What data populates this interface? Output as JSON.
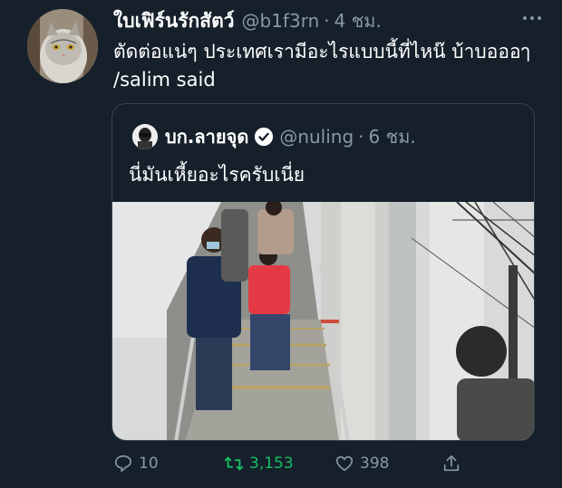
{
  "tweet": {
    "display_name": "ใบเฟิร์นรักสัตว์",
    "handle": "@b1f3rn",
    "separator": "·",
    "time": "4 ชม.",
    "text": "ตัดต่อแน่ๆ ประเทศเรามีอะไรแบบนี้ที่ไหน๊ บ้าบอออๅ /salim said"
  },
  "quoted": {
    "display_name": "บก.ลายจุด",
    "handle": "@nuling",
    "separator": "·",
    "time": "6 ชม.",
    "text": "นี่มันเหี้ยอะไรครับเนี่ย"
  },
  "actions": {
    "reply_count": "10",
    "retweet_count": "3,153",
    "like_count": "398"
  },
  "colors": {
    "background": "#15202b",
    "secondary_text": "#8899a6",
    "retweet_green": "#17bf63",
    "verified_blue": "#ffffff",
    "border": "#38444d"
  },
  "icons": [
    "more-icon",
    "verified-icon",
    "reply-icon",
    "retweet-icon",
    "like-icon",
    "share-icon"
  ]
}
